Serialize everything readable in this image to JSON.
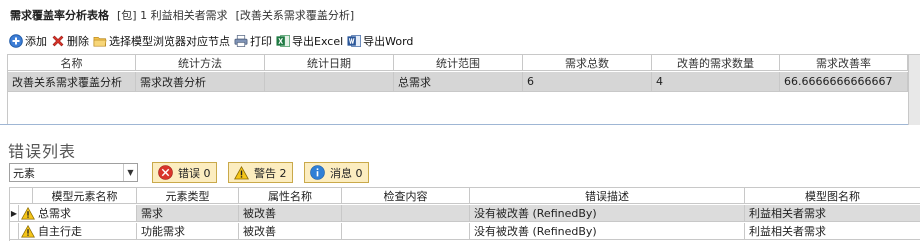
{
  "header": {
    "title": "需求覆盖率分析表格",
    "package": "[包] 1 利益相关者需求",
    "analysis": "[改善关系需求覆盖分析]"
  },
  "toolbar": {
    "add": "添加",
    "delete": "删除",
    "select_node": "选择模型浏览器对应节点",
    "print": "打印",
    "export_excel": "导出Excel",
    "export_word": "导出Word"
  },
  "coverage_table": {
    "columns": [
      "名称",
      "统计方法",
      "统计日期",
      "统计范围",
      "需求总数",
      "改善的需求数量",
      "需求改善率"
    ],
    "rows": [
      {
        "name": "改善关系需求覆盖分析",
        "method": "需求改善分析",
        "date": "",
        "scope": "总需求",
        "total": "6",
        "improved": "4",
        "rate": "66.6666666666667"
      }
    ]
  },
  "errors_panel": {
    "title": "错误列表",
    "element_filter": "元素",
    "errors_button": "错误 0",
    "warnings_button": "警告 2",
    "messages_button": "消息 0",
    "columns": [
      "模型元素名称",
      "元素类型",
      "属性名称",
      "检查内容",
      "错误描述",
      "模型图名称"
    ],
    "rows": [
      {
        "element": "总需求",
        "type": "需求",
        "property": "被改善",
        "check": "",
        "description": "没有被改善 (RefinedBy)",
        "diagram": "利益相关者需求"
      },
      {
        "element": "自主行走",
        "type": "功能需求",
        "property": "被改善",
        "check": "",
        "description": "没有被改善 (RefinedBy)",
        "diagram": "利益相关者需求"
      }
    ]
  },
  "colors": {
    "selected_row": "#d6d6d6",
    "filter_button_bg": "#fcedc0",
    "error_red": "#d9342b",
    "warning_yellow": "#f5c518",
    "info_blue": "#2f7fd6"
  }
}
